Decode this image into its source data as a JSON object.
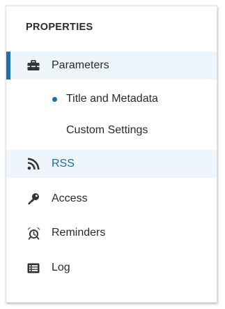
{
  "panel": {
    "heading": "PROPERTIES"
  },
  "nav": {
    "parameters": {
      "label": "Parameters",
      "icon": "toolbox-icon"
    },
    "sub_items": [
      {
        "label": "Title and Metadata",
        "selected": true
      },
      {
        "label": "Custom Settings",
        "selected": false
      }
    ],
    "rss": {
      "label": "RSS",
      "icon": "rss-icon"
    },
    "access": {
      "label": "Access",
      "icon": "key-icon"
    },
    "reminders": {
      "label": "Reminders",
      "icon": "alarm-clock-icon"
    },
    "log": {
      "label": "Log",
      "icon": "list-icon"
    }
  },
  "colors": {
    "accent": "#1b6fab",
    "active_background": "#eef5fb",
    "text": "#2a2a2a"
  }
}
